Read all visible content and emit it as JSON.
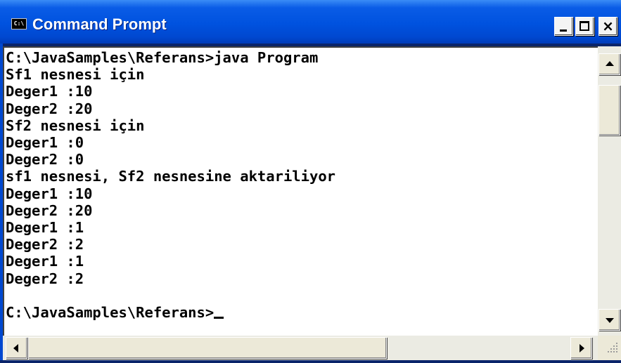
{
  "window": {
    "title": "Command Prompt",
    "icon_label": "C:\\",
    "icon": "console-icon",
    "controls": {
      "minimize_icon": "minimize-icon",
      "maximize_icon": "maximize-icon",
      "close_glyph": "×"
    }
  },
  "console": {
    "lines": [
      "C:\\JavaSamples\\Referans>java Program",
      "Sf1 nesnesi için",
      "Deger1 :10",
      "Deger2 :20",
      "Sf2 nesnesi için",
      "Deger1 :0",
      "Deger2 :0",
      "sf1 nesnesi, Sf2 nesnesine aktariliyor",
      "Deger1 :10",
      "Deger2 :20",
      "Deger1 :1",
      "Deger2 :2",
      "Deger1 :1",
      "Deger2 :2",
      "",
      "C:\\JavaSamples\\Referans>"
    ]
  },
  "colors": {
    "titlebar": "#0052df",
    "console_bg": "#ffffff",
    "console_text": "#000000"
  }
}
